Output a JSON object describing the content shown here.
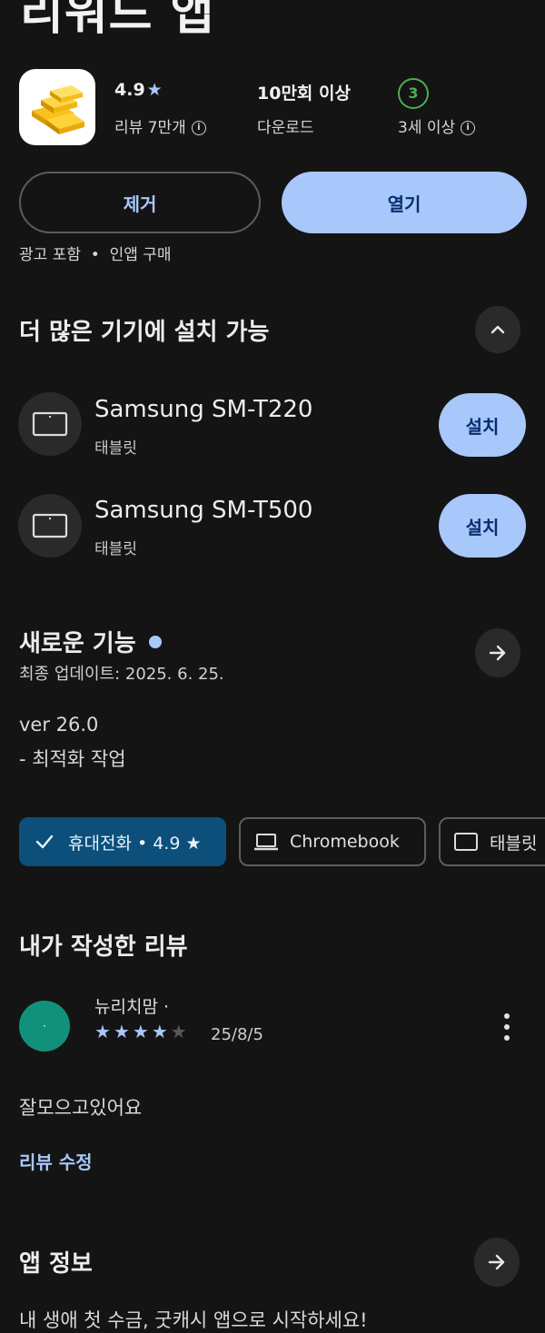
{
  "header": {
    "app_title": "리워드 앱"
  },
  "app": {
    "rating": "4.9",
    "rating_star": "★",
    "reviews_label": "리뷰 7만개",
    "downloads_value": "10만회 이상",
    "downloads_label": "다운로드",
    "age_badge": "3",
    "age_label": "3세 이상"
  },
  "actions": {
    "uninstall": "제거",
    "open": "열기"
  },
  "ads_note": "광고 포함  •  인앱 구매",
  "devices_section": {
    "title": "더 많은 기기에 설치 가능",
    "items": [
      {
        "name": "Samsung SM-T220",
        "type": "태블릿",
        "install": "설치"
      },
      {
        "name": "Samsung SM-T500",
        "type": "태블릿",
        "install": "설치"
      }
    ]
  },
  "whats_new": {
    "title": "새로운 기능",
    "updated": "최종 업데이트: 2025. 6. 25.",
    "version": "ver 26.0",
    "note": "- 최적화 작업"
  },
  "chips": [
    {
      "label": "휴대전화 • 4.9 ★",
      "selected": true
    },
    {
      "label": "Chromebook",
      "selected": false
    },
    {
      "label": "태블릿",
      "selected": false
    }
  ],
  "my_review": {
    "title": "내가 작성한 리뷰",
    "author": "뉴리치맘 ·",
    "avatar_mark": "·",
    "rating": 4,
    "date": "25/8/5",
    "text": "잘모으고있어요",
    "edit_link": "리뷰 수정"
  },
  "app_info": {
    "title": "앱 정보",
    "teaser": "내 생애 첫 수금, 굿캐시 앱으로 시작하세요!"
  },
  "colors": {
    "background": "#141414",
    "accent": "#a8c7fa",
    "accent_text": "#062e6f",
    "chip_selected": "#0b4f7a",
    "age_green": "#4caf50",
    "avatar": "#11917a"
  }
}
